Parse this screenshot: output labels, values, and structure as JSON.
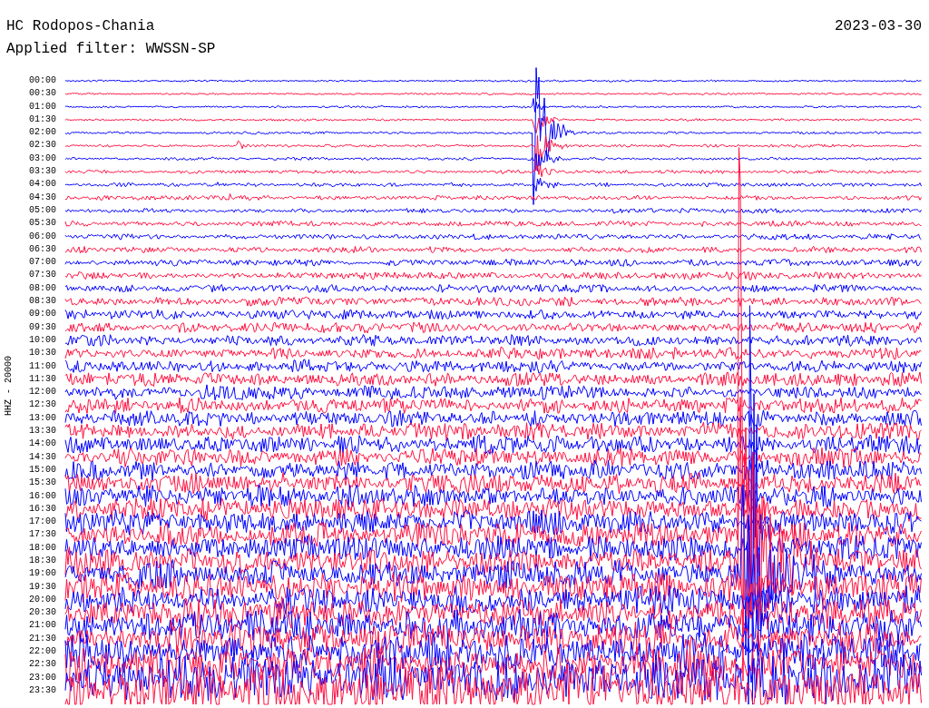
{
  "header": {
    "station": "HC Rodopos-Chania",
    "date": "2023-03-30",
    "filter": "Applied filter: WWSSN-SP"
  },
  "axis_label": "HHZ - 20000",
  "traces": [
    {
      "label": "00:00",
      "color": "#0000ff"
    },
    {
      "label": "00:30",
      "color": "#ff1040"
    },
    {
      "label": "01:00",
      "color": "#0000ff"
    },
    {
      "label": "01:30",
      "color": "#ff1040"
    },
    {
      "label": "02:00",
      "color": "#0000ff"
    },
    {
      "label": "02:30",
      "color": "#ff1040"
    },
    {
      "label": "03:00",
      "color": "#0000ff"
    },
    {
      "label": "03:30",
      "color": "#ff1040"
    },
    {
      "label": "04:00",
      "color": "#0000ff"
    },
    {
      "label": "04:30",
      "color": "#ff1040"
    },
    {
      "label": "05:00",
      "color": "#0000ff"
    },
    {
      "label": "05:30",
      "color": "#ff1040"
    },
    {
      "label": "06:00",
      "color": "#0000ff"
    },
    {
      "label": "06:30",
      "color": "#ff1040"
    },
    {
      "label": "07:00",
      "color": "#0000ff"
    },
    {
      "label": "07:30",
      "color": "#ff1040"
    },
    {
      "label": "08:00",
      "color": "#0000ff"
    },
    {
      "label": "08:30",
      "color": "#ff1040"
    },
    {
      "label": "09:00",
      "color": "#0000ff"
    },
    {
      "label": "09:30",
      "color": "#ff1040"
    },
    {
      "label": "10:00",
      "color": "#0000ff"
    },
    {
      "label": "10:30",
      "color": "#ff1040"
    },
    {
      "label": "11:00",
      "color": "#0000ff"
    },
    {
      "label": "11:30",
      "color": "#ff1040"
    },
    {
      "label": "12:00",
      "color": "#0000ff"
    },
    {
      "label": "12:30",
      "color": "#ff1040"
    },
    {
      "label": "13:00",
      "color": "#0000ff"
    },
    {
      "label": "13:30",
      "color": "#ff1040"
    },
    {
      "label": "14:00",
      "color": "#0000ff"
    },
    {
      "label": "14:30",
      "color": "#ff1040"
    },
    {
      "label": "15:00",
      "color": "#0000ff"
    },
    {
      "label": "15:30",
      "color": "#ff1040"
    },
    {
      "label": "16:00",
      "color": "#0000ff"
    },
    {
      "label": "16:30",
      "color": "#ff1040"
    },
    {
      "label": "17:00",
      "color": "#0000ff"
    },
    {
      "label": "17:30",
      "color": "#ff1040"
    },
    {
      "label": "18:00",
      "color": "#0000ff"
    },
    {
      "label": "18:30",
      "color": "#ff1040"
    },
    {
      "label": "19:00",
      "color": "#0000ff"
    },
    {
      "label": "19:30",
      "color": "#ff1040"
    },
    {
      "label": "20:00",
      "color": "#0000ff"
    },
    {
      "label": "20:30",
      "color": "#ff1040"
    },
    {
      "label": "21:00",
      "color": "#0000ff"
    },
    {
      "label": "21:30",
      "color": "#ff1040"
    },
    {
      "label": "22:00",
      "color": "#0000ff"
    },
    {
      "label": "22:30",
      "color": "#ff1040"
    },
    {
      "label": "23:00",
      "color": "#0000ff"
    },
    {
      "label": "23:30",
      "color": "#ff1040"
    }
  ]
}
